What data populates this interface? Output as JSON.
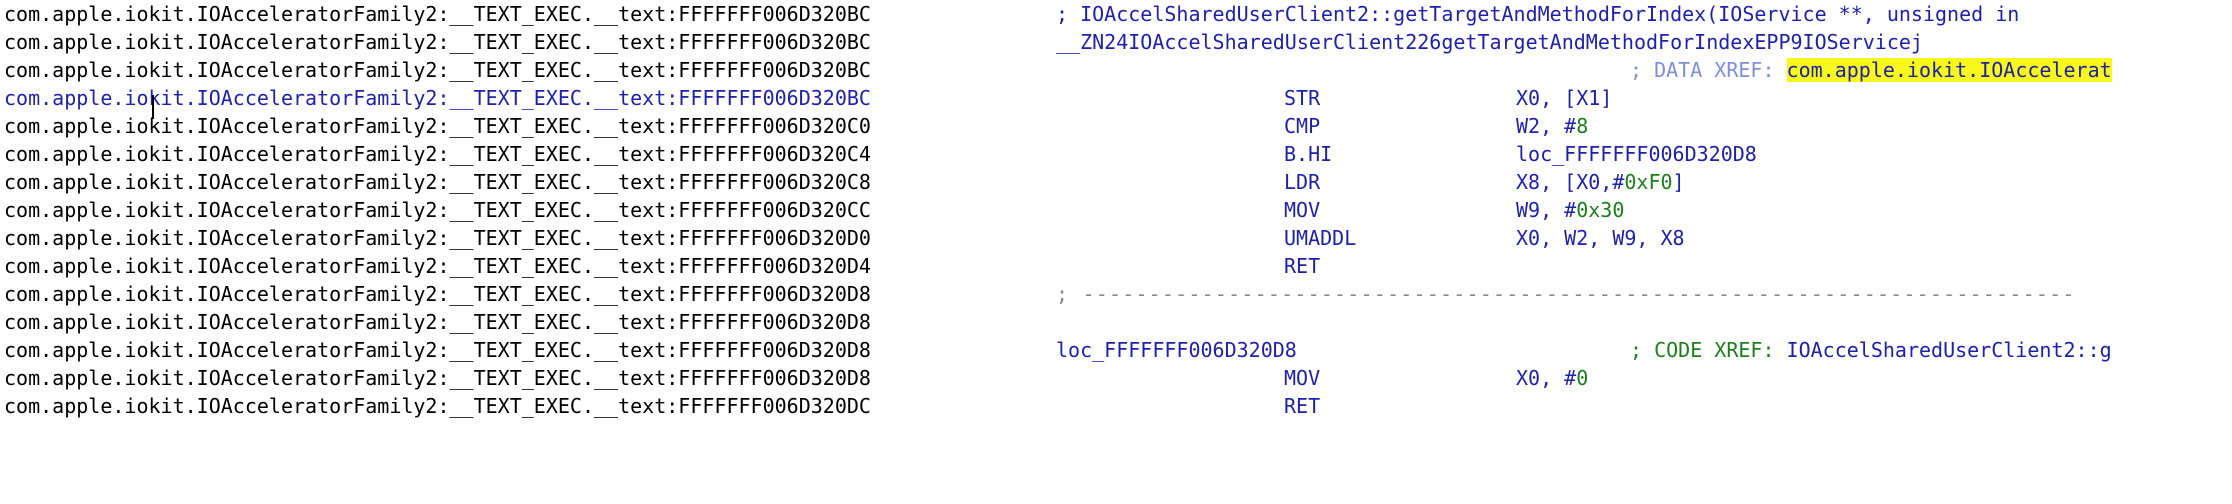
{
  "lines": [
    {
      "addr": "com.apple.iokit.IOAcceleratorFamily2:__TEXT_EXEC.__text:FFFFFFF006D320BC",
      "comment": "; IOAccelSharedUserClient2::getTargetAndMethodForIndex(IOService **, unsigned in"
    },
    {
      "addr": "com.apple.iokit.IOAcceleratorFamily2:__TEXT_EXEC.__text:FFFFFFF006D320BC",
      "label": "__ZN24IOAccelSharedUserClient226getTargetAndMethodForIndexEPP9IOServicej"
    },
    {
      "addr": "com.apple.iokit.IOAcceleratorFamily2:__TEXT_EXEC.__text:FFFFFFF006D320BC",
      "xref_prefix": "; DATA XREF: ",
      "xref_target": "com.apple.iokit.IOAccelerat"
    },
    {
      "addr": "com.apple.iokit.IOAcceleratorFamily2:__TEXT_EXEC.__text:FFFFFFF006D320BC",
      "mnemonic": "STR",
      "operands": "X0, [X1]"
    },
    {
      "addr": "com.apple.iokit.IOAcceleratorFamily2:__TEXT_EXEC.__text:FFFFFFF006D320C0",
      "mnemonic": "CMP",
      "operands": "W2, #",
      "imm": "8"
    },
    {
      "addr": "com.apple.iokit.IOAcceleratorFamily2:__TEXT_EXEC.__text:FFFFFFF006D320C4",
      "mnemonic": "B.HI",
      "operands": "loc_FFFFFFF006D320D8"
    },
    {
      "addr": "com.apple.iokit.IOAcceleratorFamily2:__TEXT_EXEC.__text:FFFFFFF006D320C8",
      "mnemonic": "LDR",
      "operands": "X8, [X0,#",
      "imm": "0xF0",
      "suffix": "]"
    },
    {
      "addr": "com.apple.iokit.IOAcceleratorFamily2:__TEXT_EXEC.__text:FFFFFFF006D320CC",
      "mnemonic": "MOV",
      "operands": "W9, #",
      "imm": "0x30"
    },
    {
      "addr": "com.apple.iokit.IOAcceleratorFamily2:__TEXT_EXEC.__text:FFFFFFF006D320D0",
      "mnemonic": "UMADDL",
      "operands": "X0, W2, W9, X8"
    },
    {
      "addr": "com.apple.iokit.IOAcceleratorFamily2:__TEXT_EXEC.__text:FFFFFFF006D320D4",
      "mnemonic": "RET",
      "operands": ""
    },
    {
      "addr": "com.apple.iokit.IOAcceleratorFamily2:__TEXT_EXEC.__text:FFFFFFF006D320D8",
      "separator": "; ---------------------------------------------------------------------------"
    },
    {
      "addr": "com.apple.iokit.IOAcceleratorFamily2:__TEXT_EXEC.__text:FFFFFFF006D320D8"
    },
    {
      "addr": "com.apple.iokit.IOAcceleratorFamily2:__TEXT_EXEC.__text:FFFFFFF006D320D8",
      "label": "loc_FFFFFFF006D320D8",
      "code_xref_prefix": "; CODE XREF: ",
      "code_xref_target": "IOAccelSharedUserClient2::g"
    },
    {
      "addr": "com.apple.iokit.IOAcceleratorFamily2:__TEXT_EXEC.__text:FFFFFFF006D320D8",
      "mnemonic": "MOV",
      "operands": "X0, #",
      "imm": "0"
    },
    {
      "addr": "com.apple.iokit.IOAcceleratorFamily2:__TEXT_EXEC.__text:FFFFFFF006D320DC",
      "mnemonic": "RET",
      "operands": ""
    }
  ],
  "selected_line": 3,
  "colors": {
    "keyword_blue": "#1f22a8",
    "immediate_green": "#1c7f1c",
    "highlight_yellow": "#f8f91b",
    "separator_gray": "#8a8a8a"
  }
}
